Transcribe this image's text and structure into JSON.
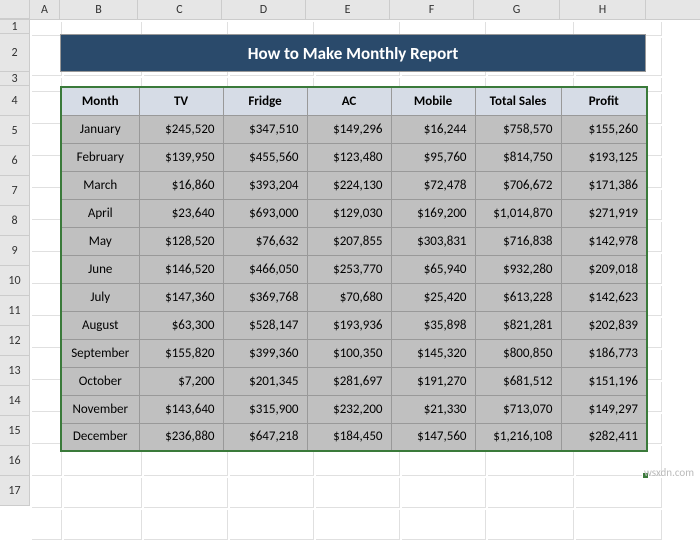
{
  "columns": [
    {
      "letter": "A",
      "width": 30
    },
    {
      "letter": "B",
      "width": 78
    },
    {
      "letter": "C",
      "width": 84
    },
    {
      "letter": "D",
      "width": 84
    },
    {
      "letter": "E",
      "width": 84
    },
    {
      "letter": "F",
      "width": 84
    },
    {
      "letter": "G",
      "width": 86
    },
    {
      "letter": "H",
      "width": 86
    }
  ],
  "rows_start": 1,
  "rows_end": 17,
  "row_heights": {
    "1": 14,
    "2": 38,
    "3": 14,
    "default": 30
  },
  "title": "How to Make Monthly Report",
  "headers": [
    "Month",
    "TV",
    "Fridge",
    "AC",
    "Mobile",
    "Total Sales",
    "Profit"
  ],
  "data": [
    {
      "month": "January",
      "tv": "$245,520",
      "fridge": "$347,510",
      "ac": "$149,296",
      "mobile": "$16,244",
      "total": "$758,570",
      "profit": "$155,260"
    },
    {
      "month": "February",
      "tv": "$139,950",
      "fridge": "$455,560",
      "ac": "$123,480",
      "mobile": "$95,760",
      "total": "$814,750",
      "profit": "$193,125"
    },
    {
      "month": "March",
      "tv": "$16,860",
      "fridge": "$393,204",
      "ac": "$224,130",
      "mobile": "$72,478",
      "total": "$706,672",
      "profit": "$171,386"
    },
    {
      "month": "April",
      "tv": "$23,640",
      "fridge": "$693,000",
      "ac": "$129,030",
      "mobile": "$169,200",
      "total": "$1,014,870",
      "profit": "$271,919"
    },
    {
      "month": "May",
      "tv": "$128,520",
      "fridge": "$76,632",
      "ac": "$207,855",
      "mobile": "$303,831",
      "total": "$716,838",
      "profit": "$142,978"
    },
    {
      "month": "June",
      "tv": "$146,520",
      "fridge": "$466,050",
      "ac": "$253,770",
      "mobile": "$65,940",
      "total": "$932,280",
      "profit": "$209,018"
    },
    {
      "month": "July",
      "tv": "$147,360",
      "fridge": "$369,768",
      "ac": "$70,680",
      "mobile": "$25,420",
      "total": "$613,228",
      "profit": "$142,623"
    },
    {
      "month": "August",
      "tv": "$63,300",
      "fridge": "$528,147",
      "ac": "$193,936",
      "mobile": "$35,898",
      "total": "$821,281",
      "profit": "$202,839"
    },
    {
      "month": "September",
      "tv": "$155,820",
      "fridge": "$399,360",
      "ac": "$100,350",
      "mobile": "$145,320",
      "total": "$800,850",
      "profit": "$186,773"
    },
    {
      "month": "October",
      "tv": "$7,200",
      "fridge": "$201,345",
      "ac": "$281,697",
      "mobile": "$191,270",
      "total": "$681,512",
      "profit": "$151,196"
    },
    {
      "month": "November",
      "tv": "$143,640",
      "fridge": "$315,900",
      "ac": "$232,200",
      "mobile": "$21,330",
      "total": "$713,070",
      "profit": "$149,297"
    },
    {
      "month": "December",
      "tv": "$236,880",
      "fridge": "$647,218",
      "ac": "$184,450",
      "mobile": "$147,560",
      "total": "$1,216,108",
      "profit": "$282,411"
    }
  ],
  "watermark": "wsxdn.com"
}
